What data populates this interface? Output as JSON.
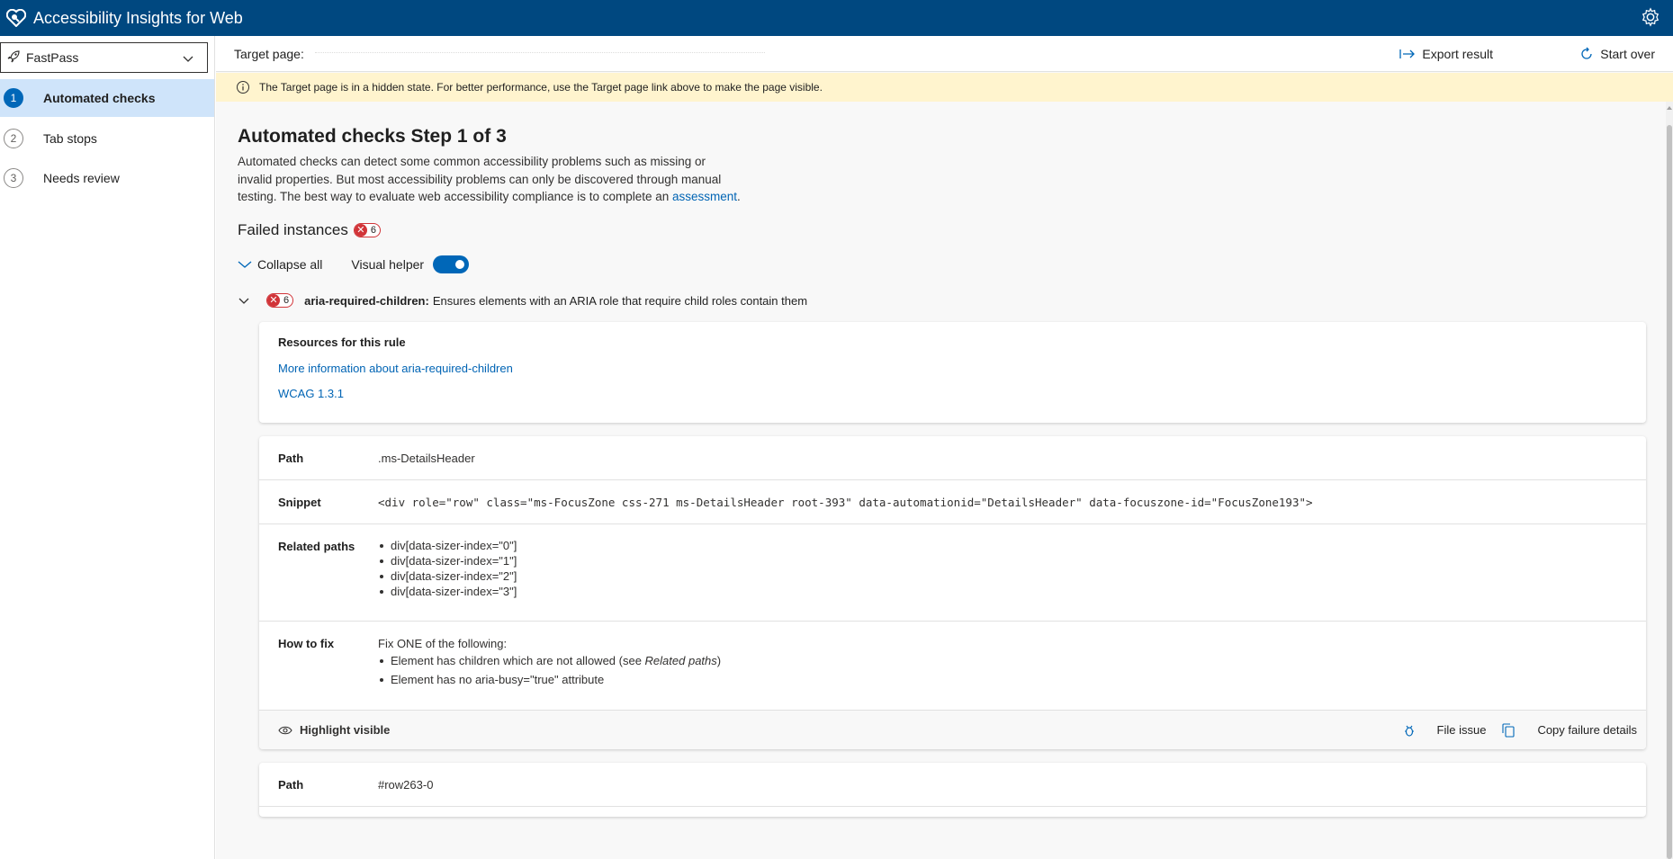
{
  "app": {
    "title": "Accessibility Insights for Web"
  },
  "sidebar": {
    "mode": "FastPass",
    "items": [
      {
        "num": "1",
        "label": "Automated checks"
      },
      {
        "num": "2",
        "label": "Tab stops"
      },
      {
        "num": "3",
        "label": "Needs review"
      }
    ]
  },
  "cmdbar": {
    "target_label": "Target page:",
    "export": "Export result",
    "start_over": "Start over"
  },
  "warning": "The Target page is in a hidden state. For better performance, use the Target page link above to make the page visible.",
  "main": {
    "title": "Automated checks Step 1 of 3",
    "desc_text": "Automated checks can detect some common accessibility problems such as missing or invalid properties. But most accessibility problems can only be discovered through manual testing. The best way to evaluate web accessibility compliance is to complete an ",
    "desc_link": "assessment",
    "desc_end": ".",
    "failed_title": "Failed instances",
    "failed_count": "6",
    "collapse_all": "Collapse all",
    "visual_helper": "Visual helper"
  },
  "rule": {
    "count": "6",
    "id": "aria-required-children:",
    "description": "Ensures elements with an ARIA role that require child roles contain them",
    "resources_title": "Resources for this rule",
    "more_info": "More information about aria-required-children",
    "wcag": "WCAG 1.3.1"
  },
  "instance1": {
    "path_label": "Path",
    "path": ".ms-DetailsHeader",
    "snippet_label": "Snippet",
    "snippet": "<div role=\"row\" class=\"ms-FocusZone css-271 ms-DetailsHeader root-393\" data-automationid=\"DetailsHeader\" data-focuszone-id=\"FocusZone193\">",
    "related_label": "Related paths",
    "related": [
      "div[data-sizer-index=\"0\"]",
      "div[data-sizer-index=\"1\"]",
      "div[data-sizer-index=\"2\"]",
      "div[data-sizer-index=\"3\"]"
    ],
    "fix_label": "How to fix",
    "fix_intro": "Fix ONE of the following:",
    "fix1_text": "Element has children which are not allowed (see ",
    "fix1_em": "Related paths",
    "fix1_end": ")",
    "fix2": "Element has no aria-busy=\"true\" attribute",
    "highlight": "Highlight visible",
    "file_issue": "File issue",
    "copy": "Copy failure details"
  },
  "instance2": {
    "path_label": "Path",
    "path": "#row263-0"
  },
  "colors": {
    "header": "#004880",
    "accent": "#0067b8",
    "error": "#d13438",
    "warning_bg": "#fff4ce",
    "selected_nav": "#cfe4fa"
  }
}
